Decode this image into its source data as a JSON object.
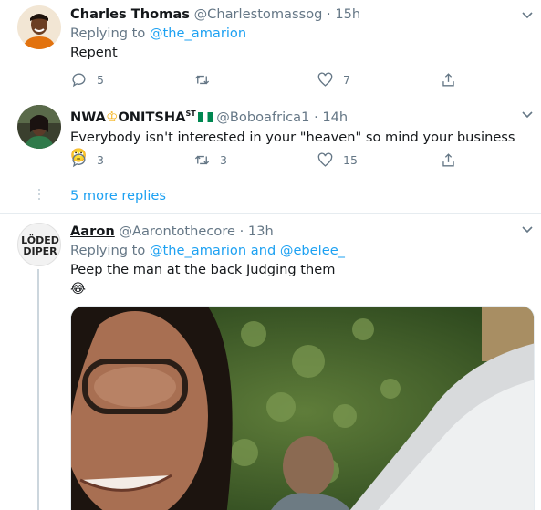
{
  "tweets": [
    {
      "name": "Charles Thomas",
      "handle": "@Charlestomassog",
      "sep": "·",
      "time": "15h",
      "replying_prefix": "Replying to ",
      "replying_to": "@the_amarion",
      "text": "Repent",
      "replies": "5",
      "retweets": "",
      "likes": "7"
    },
    {
      "name": "NWA",
      "name_suffix": "ONITSHA",
      "name_super": "ST",
      "handle": "@Boboafrica1",
      "sep": "·",
      "time": "14h",
      "text": "Everybody isn't interested in your \"heaven\" so mind your business 🙄",
      "replies": "3",
      "retweets": "3",
      "likes": "15"
    },
    {
      "name": "Aaron",
      "handle": "@Aarontothecore",
      "sep": "·",
      "time": "13h",
      "replying_prefix": "Replying to ",
      "replying_to": "@the_amarion",
      "replying_and": " and ",
      "replying_to_2": "@ebelee_",
      "text": "Peep the man at the back Judging them",
      "emoji": "😂",
      "avatar_logo": [
        "LÖDED",
        "DIPER"
      ]
    }
  ],
  "more_replies": "5 more replies",
  "colors": {
    "accent": "#1da1f2",
    "muted": "#657786",
    "text": "#14171a",
    "border": "#e6ecf0"
  },
  "icons": [
    "reply-icon",
    "retweet-icon",
    "like-icon",
    "share-icon",
    "chevron-down-icon"
  ]
}
